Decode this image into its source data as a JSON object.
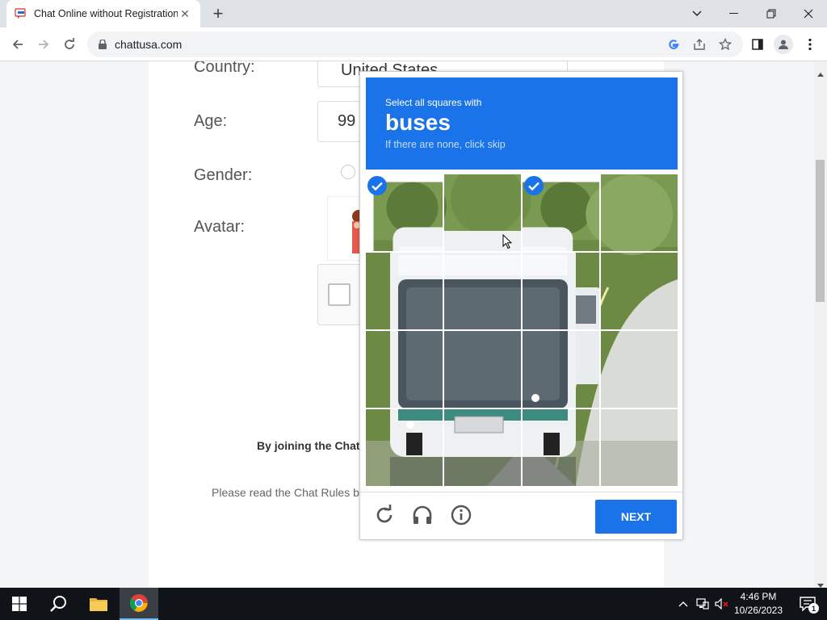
{
  "browser": {
    "tab_title": "Chat Online without Registration",
    "url": "chattusa.com"
  },
  "form": {
    "country_label": "Country:",
    "country_value": "United States",
    "age_label": "Age:",
    "age_value": "99",
    "gender_label": "Gender:",
    "avatar_label": "Avatar:",
    "terms_text": "By joining the Chat",
    "rules_text": "Please read the Chat Rules b"
  },
  "captcha": {
    "instruction": "Select all squares with",
    "target": "buses",
    "hint": "If there are none, click skip",
    "next_label": "NEXT",
    "selected_tiles": [
      0,
      2
    ],
    "grid_size": 4
  },
  "taskbar": {
    "time": "4:46 PM",
    "date": "10/26/2023",
    "notification_count": "1"
  },
  "colors": {
    "accent": "#1a73e8",
    "taskbar": "#101418"
  }
}
